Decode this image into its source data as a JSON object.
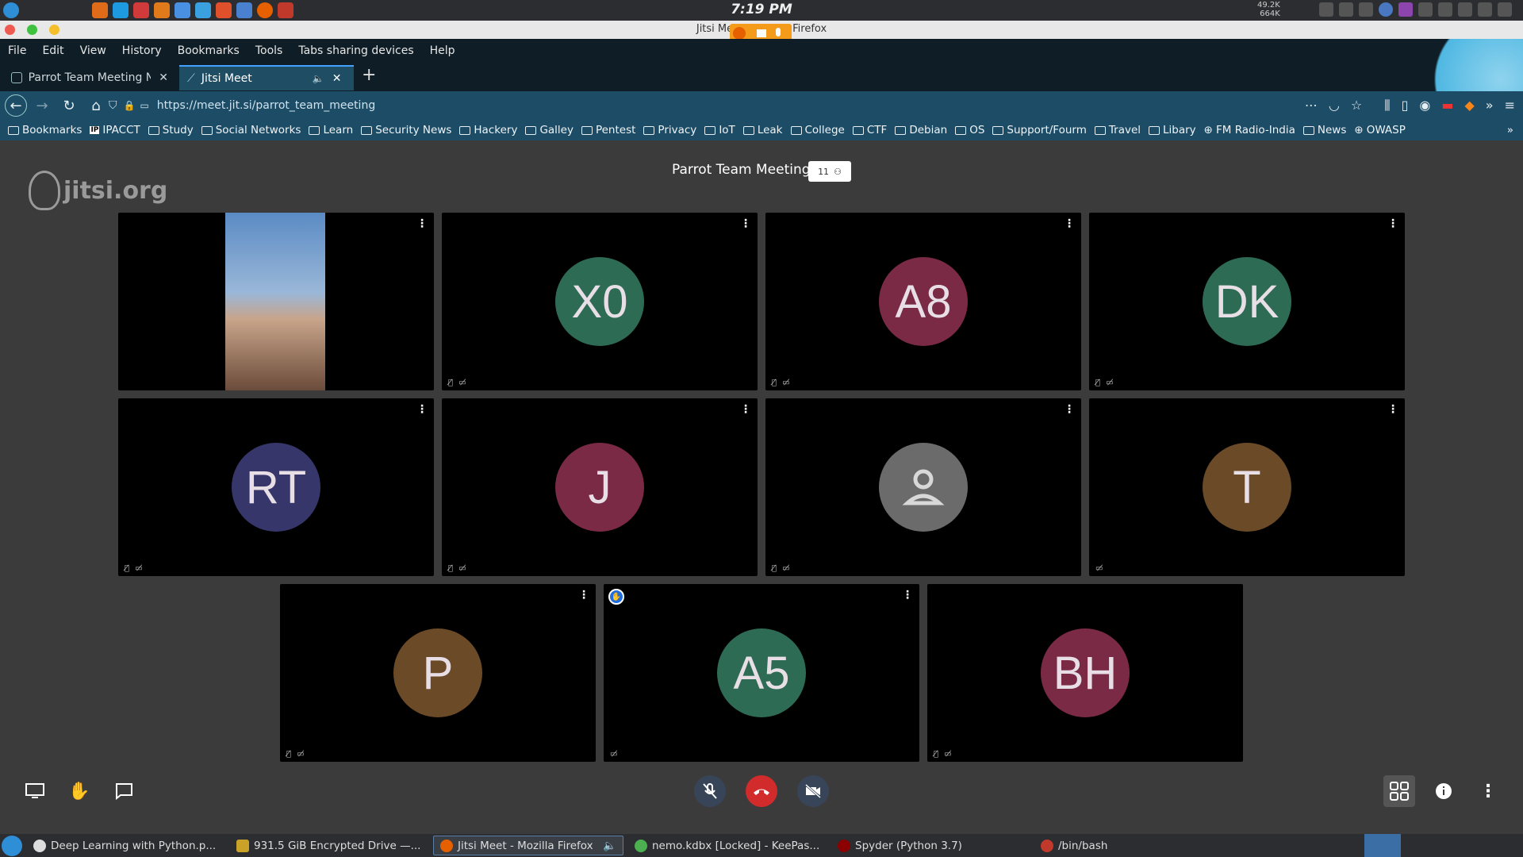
{
  "system": {
    "clock": "7:19 PM",
    "net_up": "49.2K",
    "net_down": "664K"
  },
  "window": {
    "title": "Jitsi Meet - Mozilla Firefox"
  },
  "menubar": [
    "File",
    "Edit",
    "View",
    "History",
    "Bookmarks",
    "Tools",
    "Tabs sharing devices",
    "Help"
  ],
  "tabs": [
    {
      "label": "Parrot Team Meeting Now",
      "active": false
    },
    {
      "label": "Jitsi Meet",
      "active": true
    }
  ],
  "address": {
    "url": "https://meet.jit.si/parrot_team_meeting"
  },
  "bookmarks": [
    "Bookmarks",
    "IPACCT",
    "Study",
    "Social Networks",
    "Learn",
    "Security News",
    "Hackery",
    "Galley",
    "Pentest",
    "Privacy",
    "IoT",
    "Leak",
    "College",
    "CTF",
    "Debian",
    "OS",
    "Support/Fourm",
    "Travel",
    "Libary",
    "FM Radio-India",
    "News",
    "OWASP"
  ],
  "meeting": {
    "logo": "jitsi.org",
    "title": "Parrot Team Meeting",
    "participant_count": "11",
    "participants": [
      {
        "initials": "",
        "color": "",
        "video": true
      },
      {
        "initials": "X0",
        "color": "#2e6b55"
      },
      {
        "initials": "A8",
        "color": "#7a2a45"
      },
      {
        "initials": "DK",
        "color": "#2e6b55"
      },
      {
        "initials": "RT",
        "color": "#36366b"
      },
      {
        "initials": "J",
        "color": "#7a2a45"
      },
      {
        "initials": "",
        "color": "#6b6b6b",
        "generic": true
      },
      {
        "initials": "T",
        "color": "#6b4a28"
      },
      {
        "initials": "P",
        "color": "#6b4a28"
      },
      {
        "initials": "A5",
        "color": "#2e6b55",
        "hand_raised": true
      },
      {
        "initials": "BH",
        "color": "#7a2a45"
      }
    ]
  },
  "taskbar": [
    {
      "label": "Deep Learning with  Python.p...",
      "active": false,
      "color": "#ddd"
    },
    {
      "label": "931.5 GiB Encrypted Drive —...",
      "active": false,
      "color": "#c9a227"
    },
    {
      "label": "Jitsi Meet - Mozilla Firefox",
      "active": true,
      "color": "#e66000"
    },
    {
      "label": "nemo.kdbx [Locked] - KeePas...",
      "active": false,
      "color": "#4caf50"
    },
    {
      "label": "Spyder (Python 3.7)",
      "active": false,
      "color": "#8b0000"
    },
    {
      "label": "/bin/bash",
      "active": false,
      "color": "#c0392b"
    }
  ]
}
